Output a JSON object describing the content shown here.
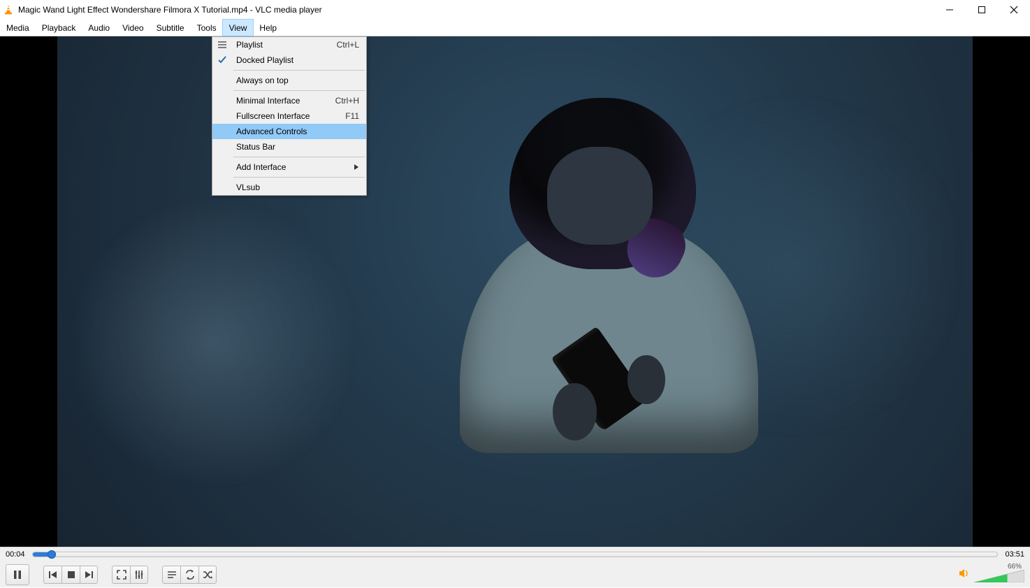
{
  "titlebar": {
    "title": "Magic Wand Light Effect  Wondershare Filmora X Tutorial.mp4 - VLC media player"
  },
  "menu": {
    "items": [
      "Media",
      "Playback",
      "Audio",
      "Video",
      "Subtitle",
      "Tools",
      "View",
      "Help"
    ],
    "selected_index": 6
  },
  "view_menu": {
    "items": [
      {
        "label": "Playlist",
        "shortcut": "Ctrl+L",
        "icon": "playlist"
      },
      {
        "label": "Docked Playlist",
        "checked": true
      },
      {
        "sep": true
      },
      {
        "label": "Always on top"
      },
      {
        "sep": true
      },
      {
        "label": "Minimal Interface",
        "shortcut": "Ctrl+H"
      },
      {
        "label": "Fullscreen Interface",
        "shortcut": "F11"
      },
      {
        "label": "Advanced Controls",
        "highlighted": true
      },
      {
        "label": "Status Bar"
      },
      {
        "sep": true
      },
      {
        "label": "Add Interface",
        "submenu": true
      },
      {
        "sep": true
      },
      {
        "label": "VLsub"
      }
    ]
  },
  "playback": {
    "current_time": "00:04",
    "total_time": "03:51",
    "progress_percent": 2
  },
  "volume": {
    "percent_label": "66%",
    "percent": 66
  },
  "controls": {
    "play_pause": "pause",
    "buttons": {
      "prev": "Previous",
      "stop": "Stop",
      "next": "Next",
      "fullscreen": "Fullscreen",
      "ext": "Extended settings",
      "playlist": "Playlist",
      "loop": "Loop",
      "shuffle": "Shuffle"
    }
  }
}
